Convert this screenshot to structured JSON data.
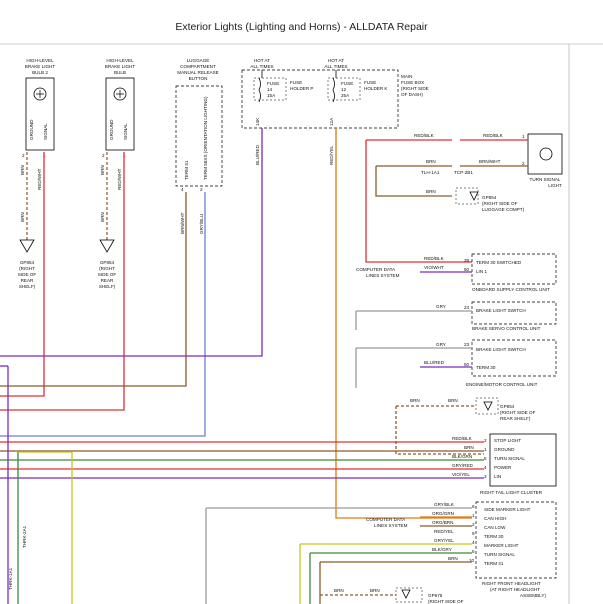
{
  "header": {
    "title": "Exterior Lights (Lighting and Horns) - ALLDATA Repair"
  },
  "components": {
    "bulb_left": {
      "title": [
        "HIGH-LEVEL",
        "BRAKE LIGHT",
        "BULB 2"
      ],
      "pins": [
        "GROUND",
        "SIGNAL"
      ],
      "pin_nums": [
        "2",
        "1"
      ]
    },
    "bulb_right": {
      "title": [
        "HIGH-LEVEL",
        "BRAKE LIGHT",
        "BULB"
      ],
      "pins": [
        "GROUND",
        "SIGNAL"
      ],
      "pin_nums": [
        "2",
        "1"
      ]
    },
    "luggage_button": {
      "title": [
        "LUGGAGE",
        "COMPARTMENT",
        "MANUAL RELEASE",
        "BUTTON"
      ],
      "pins": [
        "TERM 31",
        "TERM 58XS (ORIENTATION LIGHTING)"
      ],
      "pin_nums": [
        "4",
        "2"
      ]
    },
    "fuse_p": {
      "hot": [
        "HOT AT",
        "ALL TIMES"
      ],
      "fuse": [
        "FUSE",
        "14",
        "15A"
      ],
      "holder": [
        "FUSE",
        "HOLDER P"
      ],
      "pin": "14K"
    },
    "fuse_k": {
      "hot": [
        "HOT AT",
        "ALL TIMES"
      ],
      "fuse": [
        "FUSE",
        "12",
        "25A"
      ],
      "holder": [
        "FUSE",
        "HOLDER K"
      ],
      "pin": "12A"
    },
    "main_fuse_box": [
      "MAIN",
      "FUSE BOX",
      "(RIGHT SIDE",
      "OF DASH)"
    ],
    "turn_signal_light": {
      "label": [
        "TURN SIGNAL",
        "LIGHT"
      ],
      "pins": [
        "1",
        "2"
      ]
    },
    "gp854_luggage": [
      "GP854",
      "(RIGHT SIDE OF",
      "LUGGAGE COMPT)"
    ],
    "gp854_left": [
      "GP854",
      "(RIGHT",
      "SIDE OF",
      "REAR",
      "SHELF)"
    ],
    "gp854_right": [
      "GP854",
      "(RIGHT",
      "SIDE OF",
      "REAR",
      "SHELF)"
    ],
    "onboard_supply": {
      "pins": [
        "TERM 30 SWITCHED",
        "LIN 1"
      ],
      "nums": [
        "39",
        "50"
      ],
      "name": "ONBOARD SUPPLY CONTROL UNIT"
    },
    "brake_servo": {
      "pins": [
        "BRAKE LIGHT SWITCH"
      ],
      "nums": [
        "24"
      ],
      "name": "BRAKE SERVO CONTROL UNIT"
    },
    "engine_motor": {
      "pins": [
        "BRAKE LIGHT SWITCH",
        "TERM 30"
      ],
      "nums": [
        "23",
        "50"
      ],
      "name": "ENGINE/MOTOR CONTROL UNIT"
    },
    "gp854_rear_shelf": [
      "GP854",
      "(RIGHT SIDE OF",
      "REAR SHELF)"
    ],
    "right_tail": {
      "pins": [
        "STOP LIGHT",
        "GROUND",
        "TURN SIGNAL",
        "POWER",
        "LIN"
      ],
      "nums": [
        "2",
        "1",
        "5",
        "4",
        "3"
      ],
      "name": "RIGHT TAIL LIGHT CLUSTER"
    },
    "right_headlight": {
      "pins": [
        "SIDE MARKER LIGHT",
        "CAN HIGH",
        "CAN LOW",
        "TERM 30",
        "MARKER LIGHT",
        "TURN SIGNAL",
        "TERM 31"
      ],
      "nums": [
        "6",
        "1",
        "2",
        "9",
        "4",
        "5",
        "10"
      ],
      "name": [
        "RIGHT FRONT HEADLIGHT",
        "(AT RIGHT HEADLIGHT",
        "ASSEMBLY)"
      ]
    },
    "gp675": [
      "GP675",
      "(RIGHT SIDE OF"
    ],
    "computer_data_1": [
      "COMPUTER DATA",
      "LINES SYSTEM"
    ],
    "computer_data_2": [
      "COMPUTER DATA",
      "LINES SYSTEM"
    ],
    "connectors": {
      "tlh": "TLH-1A1",
      "tcp": "TCP-2B1",
      "thrk": "THRK-1A1",
      "thrk2": "THRK-2A1"
    }
  },
  "wires": {
    "bulb_left": [
      "BRN",
      "RED/WHT"
    ],
    "bulb_right": [
      "BRN",
      "RED/WHT"
    ],
    "bulb_gnd": [
      "BRN",
      "BRN"
    ],
    "luggage": [
      "BRN/WHT",
      "GRY/BLU"
    ],
    "fuse_p": "BLU/RED",
    "fuse_k": "RED/YEL",
    "turn_signal": [
      "RED/BLK",
      "RED/BLK",
      "BRN",
      "BRN/WHT",
      "BRN"
    ],
    "onboard": [
      "RED/BLK",
      "VIO/WHT"
    ],
    "brake_servo": "GRY",
    "engine": [
      "GRY",
      "BLU/RED"
    ],
    "gp854_rear": [
      "BRN",
      "BRN"
    ],
    "tail": [
      "RED/BLK",
      "BRN",
      "BLK/GRN",
      "GRY/RED",
      "VIO/YEL"
    ],
    "headlight": [
      "GRY/BLK",
      "ORG/GRN",
      "ORG/BRN",
      "RED/YEL",
      "GRY/YEL",
      "BLK/GRY",
      "BRN"
    ],
    "gp675": [
      "BRN",
      "BRN"
    ]
  },
  "colors": {
    "red": "#e03030",
    "brown": "#8b5a2b",
    "violet": "#7a2bbf",
    "blue": "#6b7fd6",
    "gray": "#9a9a9a",
    "orange": "#e07a10",
    "green": "#3a8a3a",
    "yellow": "#c8c81e"
  }
}
